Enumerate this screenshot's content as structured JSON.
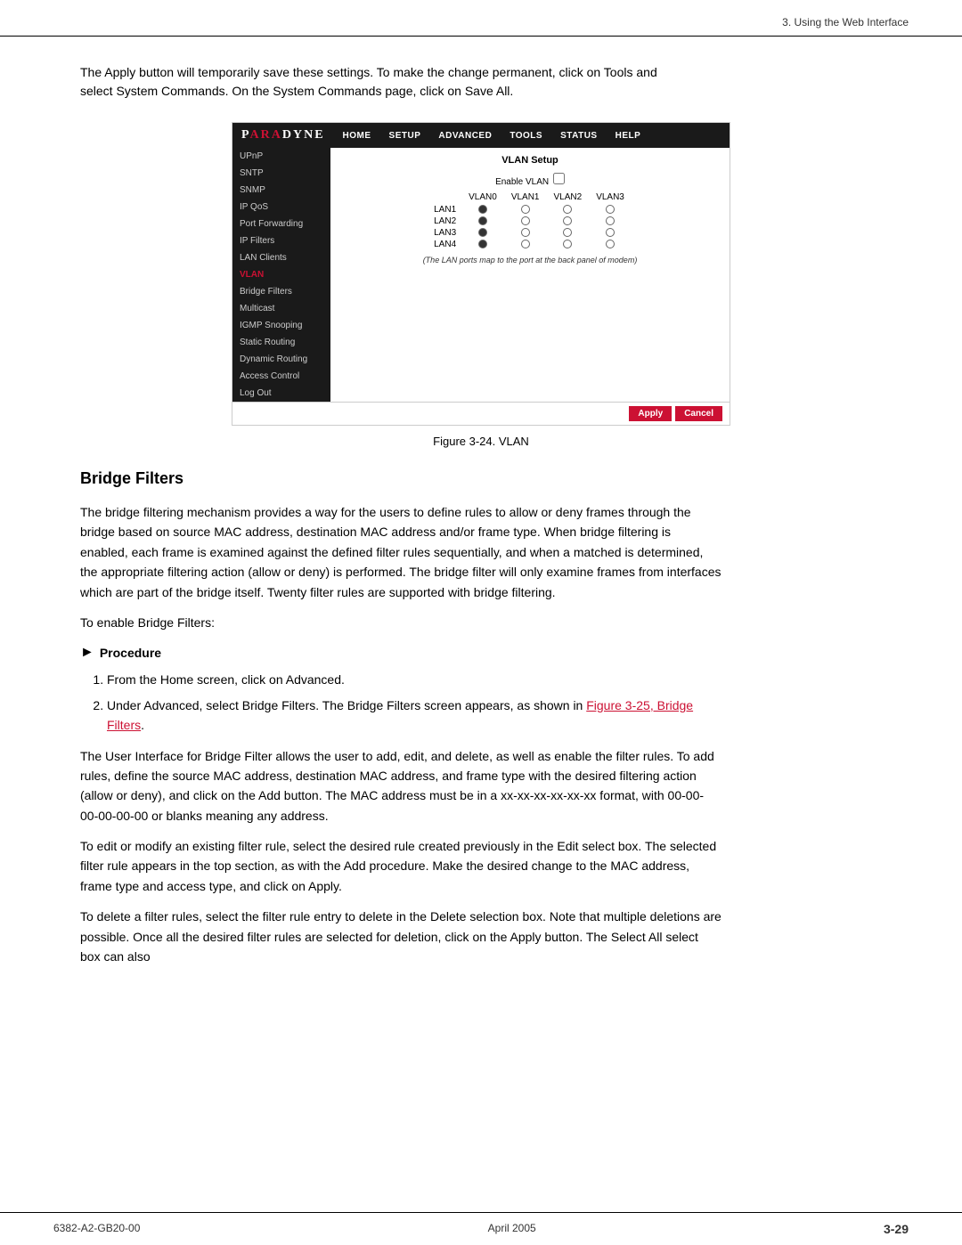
{
  "page": {
    "header": "3. Using the Web Interface",
    "footer_left": "6382-A2-GB20-00",
    "footer_center": "April 2005",
    "footer_right": "3-29"
  },
  "intro": {
    "paragraph": "The Apply button will temporarily save these settings. To make the change permanent, click on Tools and select System Commands. On the System Commands page, click on Save All."
  },
  "router_ui": {
    "logo": "PARADYNE",
    "nav_items": [
      "HOME",
      "SETUP",
      "ADVANCED",
      "TOOLS",
      "STATUS",
      "HELP"
    ],
    "sidebar_items": [
      {
        "label": "UPnP",
        "active": false
      },
      {
        "label": "SNTP",
        "active": false
      },
      {
        "label": "SNMP",
        "active": false
      },
      {
        "label": "IP QoS",
        "active": false
      },
      {
        "label": "Port Forwarding",
        "active": false
      },
      {
        "label": "IP Filters",
        "active": false
      },
      {
        "label": "LAN Clients",
        "active": false
      },
      {
        "label": "VLAN",
        "active": true,
        "highlight": true
      },
      {
        "label": "Bridge Filters",
        "active": false
      },
      {
        "label": "Multicast",
        "active": false
      },
      {
        "label": "IGMP Snooping",
        "active": false
      },
      {
        "label": "Static Routing",
        "active": false
      },
      {
        "label": "Dynamic Routing",
        "active": false
      },
      {
        "label": "Access Control",
        "active": false
      },
      {
        "label": "Log Out",
        "active": false
      }
    ],
    "panel_title": "VLAN Setup",
    "enable_label": "Enable VLAN",
    "vlan_headers": [
      "VLAN0",
      "VLAN1",
      "VLAN2",
      "VLAN3"
    ],
    "lan_rows": [
      "LAN1",
      "LAN2",
      "LAN3",
      "LAN4"
    ],
    "note": "(The LAN ports map to the port at the back panel of modem)",
    "apply_label": "Apply",
    "cancel_label": "Cancel"
  },
  "figure_caption": "Figure 3-24.   VLAN",
  "bridge_filters": {
    "heading": "Bridge Filters",
    "para1": "The bridge filtering mechanism provides a way for the users to define rules to allow or deny frames through the bridge based on source MAC address, destination MAC address and/or frame type. When bridge filtering is enabled, each frame is examined against the defined filter rules sequentially, and when a matched is determined, the appropriate filtering action (allow or deny) is performed. The bridge filter will only examine frames from interfaces which are part of the bridge itself. Twenty filter rules are supported with bridge filtering.",
    "para2": "To enable Bridge Filters:",
    "procedure_label": "Procedure",
    "steps": [
      "From the Home screen, click on Advanced.",
      "Under Advanced, select Bridge Filters.  The Bridge Filters screen appears, as shown in Figure 3-25, Bridge Filters."
    ],
    "link_text": "Figure 3-25, Bridge Filters",
    "para3": "The User Interface for Bridge Filter allows the user to add, edit, and delete, as well as enable the filter rules. To add rules, define the source MAC address, destination MAC address, and frame type with the desired filtering action (allow or deny), and click on the Add button. The MAC address must be in a xx-xx-xx-xx-xx-xx format, with 00-00-00-00-00-00 or blanks meaning any address.",
    "para4": "To edit or modify an existing filter rule, select the desired rule created previously in the Edit select box. The selected filter rule appears in the top section, as with the Add procedure. Make the desired change to the MAC address, frame type and access type, and click on Apply.",
    "para5": "To delete a filter rules, select the filter rule entry to delete in the Delete selection box. Note that multiple deletions are possible. Once all the desired filter rules are selected for deletion, click on the Apply button. The Select All select box can also"
  }
}
